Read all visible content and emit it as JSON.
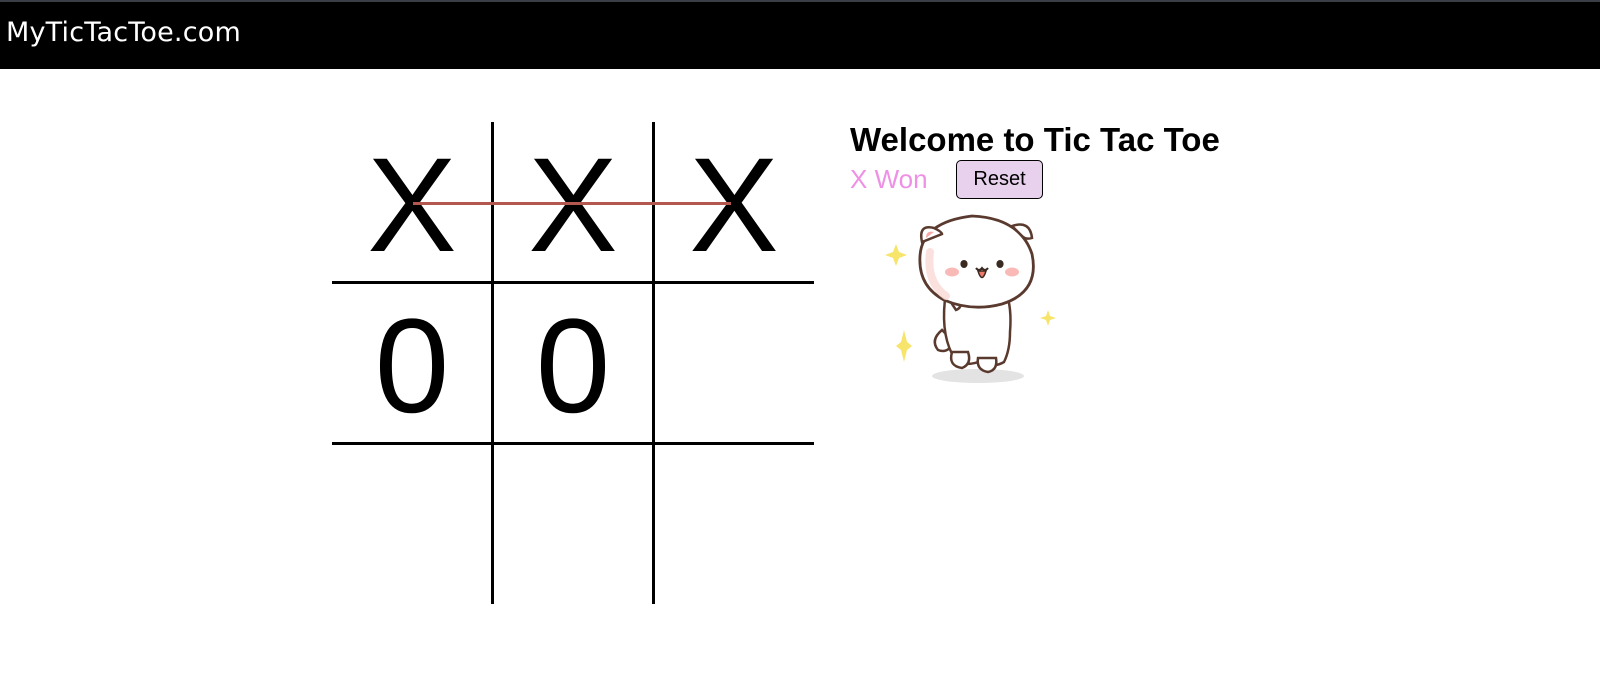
{
  "header": {
    "brand": "MyTicTacToe.com"
  },
  "board": {
    "cells": [
      "X",
      "X",
      "X",
      "0",
      "0",
      "",
      "",
      "",
      ""
    ],
    "winning_line": "top-row",
    "win_line_color": "#b4584f"
  },
  "panel": {
    "title": "Welcome to Tic Tac Toe",
    "status": "X Won",
    "status_color": "#ee90e6",
    "reset_label": "Reset",
    "reset_bg": "#e7d1ec",
    "celebration_image": "dancing-cat-icon"
  }
}
